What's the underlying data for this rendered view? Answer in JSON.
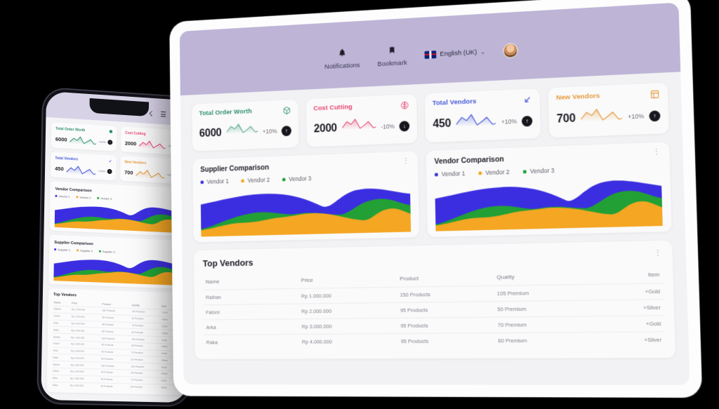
{
  "topbar": {
    "notifications_label": "Notifications",
    "bookmark_label": "Bookmark",
    "language": "English (UK)",
    "bell_icon": "bell-icon",
    "bookmark_icon": "bookmark-icon",
    "chevron": "⌄"
  },
  "stats": [
    {
      "title": "Total Order Worth",
      "value": "6000",
      "pct": "+10%",
      "dir": "↑",
      "color": "#2f8f6e",
      "icon": "⬢"
    },
    {
      "title": "Cost Cutting",
      "value": "2000",
      "pct": "-10%",
      "dir": "↓",
      "color": "#e8416f",
      "icon": "⬣"
    },
    {
      "title": "Total Vendors",
      "value": "450",
      "pct": "+10%",
      "dir": "↑",
      "color": "#4758d8",
      "icon": "↙"
    },
    {
      "title": "New Vendors",
      "value": "700",
      "pct": "+10%",
      "dir": "↑",
      "color": "#e49a3c",
      "icon": "▤"
    }
  ],
  "charts": [
    {
      "title": "Supplier Comparison",
      "legend": [
        {
          "label": "Vendor 1",
          "color": "#3b2ee0"
        },
        {
          "label": "Vendor 2",
          "color": "#f5a623"
        },
        {
          "label": "Vendor 3",
          "color": "#22a035"
        }
      ],
      "menu_icon": "⋮"
    },
    {
      "title": "Vendor Comparison",
      "legend": [
        {
          "label": "Vendor 1",
          "color": "#3b2ee0"
        },
        {
          "label": "Vendor 2",
          "color": "#f5a623"
        },
        {
          "label": "Vendor 3",
          "color": "#22a035"
        }
      ],
      "menu_icon": "⋮"
    }
  ],
  "table": {
    "title": "Top Vendors",
    "menu_icon": "⋮",
    "columns": [
      "Name",
      "Price",
      "Product",
      "Quality",
      "Item"
    ],
    "rows": [
      [
        "Raihan",
        "Rp 1.000.000",
        "150 Products",
        "105 Premium",
        "+Gold"
      ],
      [
        "Fatoni",
        "Rp 2.000.000",
        "95 Products",
        "50 Premium",
        "+Silver"
      ],
      [
        "Arka",
        "Rp 3.000.000",
        "95 Products",
        "70 Premium",
        "+Gold"
      ],
      [
        "Raka",
        "Rp 4.000.000",
        "95 Products",
        "60 Premium",
        "+Silver"
      ]
    ]
  },
  "phone": {
    "bell_icon": "☇",
    "menu_icon": "☰",
    "charts": [
      {
        "title": "Vendor Comparison",
        "legend": [
          {
            "label": "Vendor 1",
            "color": "#3b2ee0"
          },
          {
            "label": "Vendor 2",
            "color": "#f5a623"
          },
          {
            "label": "Vendor 3",
            "color": "#22a035"
          }
        ]
      },
      {
        "title": "Supplier Comparison",
        "legend": [
          {
            "label": "Supplier 1",
            "color": "#3b2ee0"
          },
          {
            "label": "Supplier 2",
            "color": "#f5a623"
          },
          {
            "label": "Supplier 3",
            "color": "#22a035"
          }
        ]
      }
    ],
    "table": {
      "title": "Top Vendors",
      "columns": [
        "Name",
        "Price",
        "Product",
        "Quality",
        "Item"
      ],
      "rows": [
        [
          "Raihan",
          "Rp 1.000.000",
          "150 Products",
          "105 Premium",
          "+Gold"
        ],
        [
          "Fatoni",
          "Rp 2.000.000",
          "95 Products",
          "50 Premium",
          "+Silver"
        ],
        [
          "Arka",
          "Rp 3.000.000",
          "95 Products",
          "70 Premium",
          "+Gold"
        ],
        [
          "Raka",
          "Rp 4.000.000",
          "95 Products",
          "60 Premium",
          "+Silver"
        ],
        [
          "Raihan",
          "Rp 1.000.000",
          "150 Products",
          "105 Premium",
          "+Gold"
        ],
        [
          "Fatoni",
          "Rp 2.000.000",
          "95 Products",
          "50 Premium",
          "+Silver"
        ],
        [
          "Arka",
          "Rp 3.000.000",
          "95 Products",
          "70 Premium",
          "+Gold"
        ],
        [
          "Raka",
          "Rp 4.000.000",
          "95 Products",
          "60 Premium",
          "+Silver"
        ],
        [
          "Raihan",
          "Rp 1.000.000",
          "150 Products",
          "105 Premium",
          "+Gold"
        ],
        [
          "Fatoni",
          "Rp 2.000.000",
          "95 Products",
          "50 Premium",
          "+Silver"
        ],
        [
          "Arka",
          "Rp 3.000.000",
          "95 Products",
          "70 Premium",
          "+Gold"
        ],
        [
          "Raka",
          "Rp 4.000.000",
          "95 Products",
          "60 Premium",
          "+Silver"
        ]
      ]
    }
  },
  "chart_data": [
    {
      "type": "area",
      "title": "Supplier Comparison",
      "stacked": true,
      "x": [
        0,
        1,
        2,
        3,
        4,
        5,
        6,
        7,
        8,
        9,
        10
      ],
      "series": [
        {
          "name": "Vendor 2",
          "color": "#f5a623",
          "values": [
            14,
            24,
            22,
            30,
            44,
            44,
            40,
            40,
            30,
            50,
            52
          ]
        },
        {
          "name": "Vendor 3",
          "color": "#22a035",
          "values": [
            0,
            4,
            22,
            26,
            14,
            10,
            34,
            40,
            30,
            38,
            32
          ]
        },
        {
          "name": "Vendor 1",
          "color": "#3b2ee0",
          "values": [
            62,
            56,
            46,
            34,
            22,
            16,
            6,
            2,
            2,
            2,
            2
          ]
        }
      ],
      "ylim": [
        0,
        100
      ],
      "grid": false,
      "legend_position": "top-left"
    },
    {
      "type": "area",
      "title": "Vendor Comparison",
      "stacked": true,
      "x": [
        0,
        1,
        2,
        3,
        4,
        5,
        6,
        7,
        8,
        9,
        10
      ],
      "series": [
        {
          "name": "Vendor 2",
          "color": "#f5a623",
          "values": [
            12,
            26,
            24,
            32,
            44,
            42,
            40,
            38,
            28,
            50,
            50
          ]
        },
        {
          "name": "Vendor 3",
          "color": "#22a035",
          "values": [
            0,
            2,
            20,
            24,
            12,
            12,
            36,
            42,
            34,
            38,
            30
          ]
        },
        {
          "name": "Vendor 1",
          "color": "#3b2ee0",
          "values": [
            64,
            56,
            44,
            32,
            22,
            16,
            6,
            2,
            2,
            2,
            2
          ]
        }
      ],
      "ylim": [
        0,
        100
      ],
      "grid": false,
      "legend_position": "top-left"
    }
  ]
}
